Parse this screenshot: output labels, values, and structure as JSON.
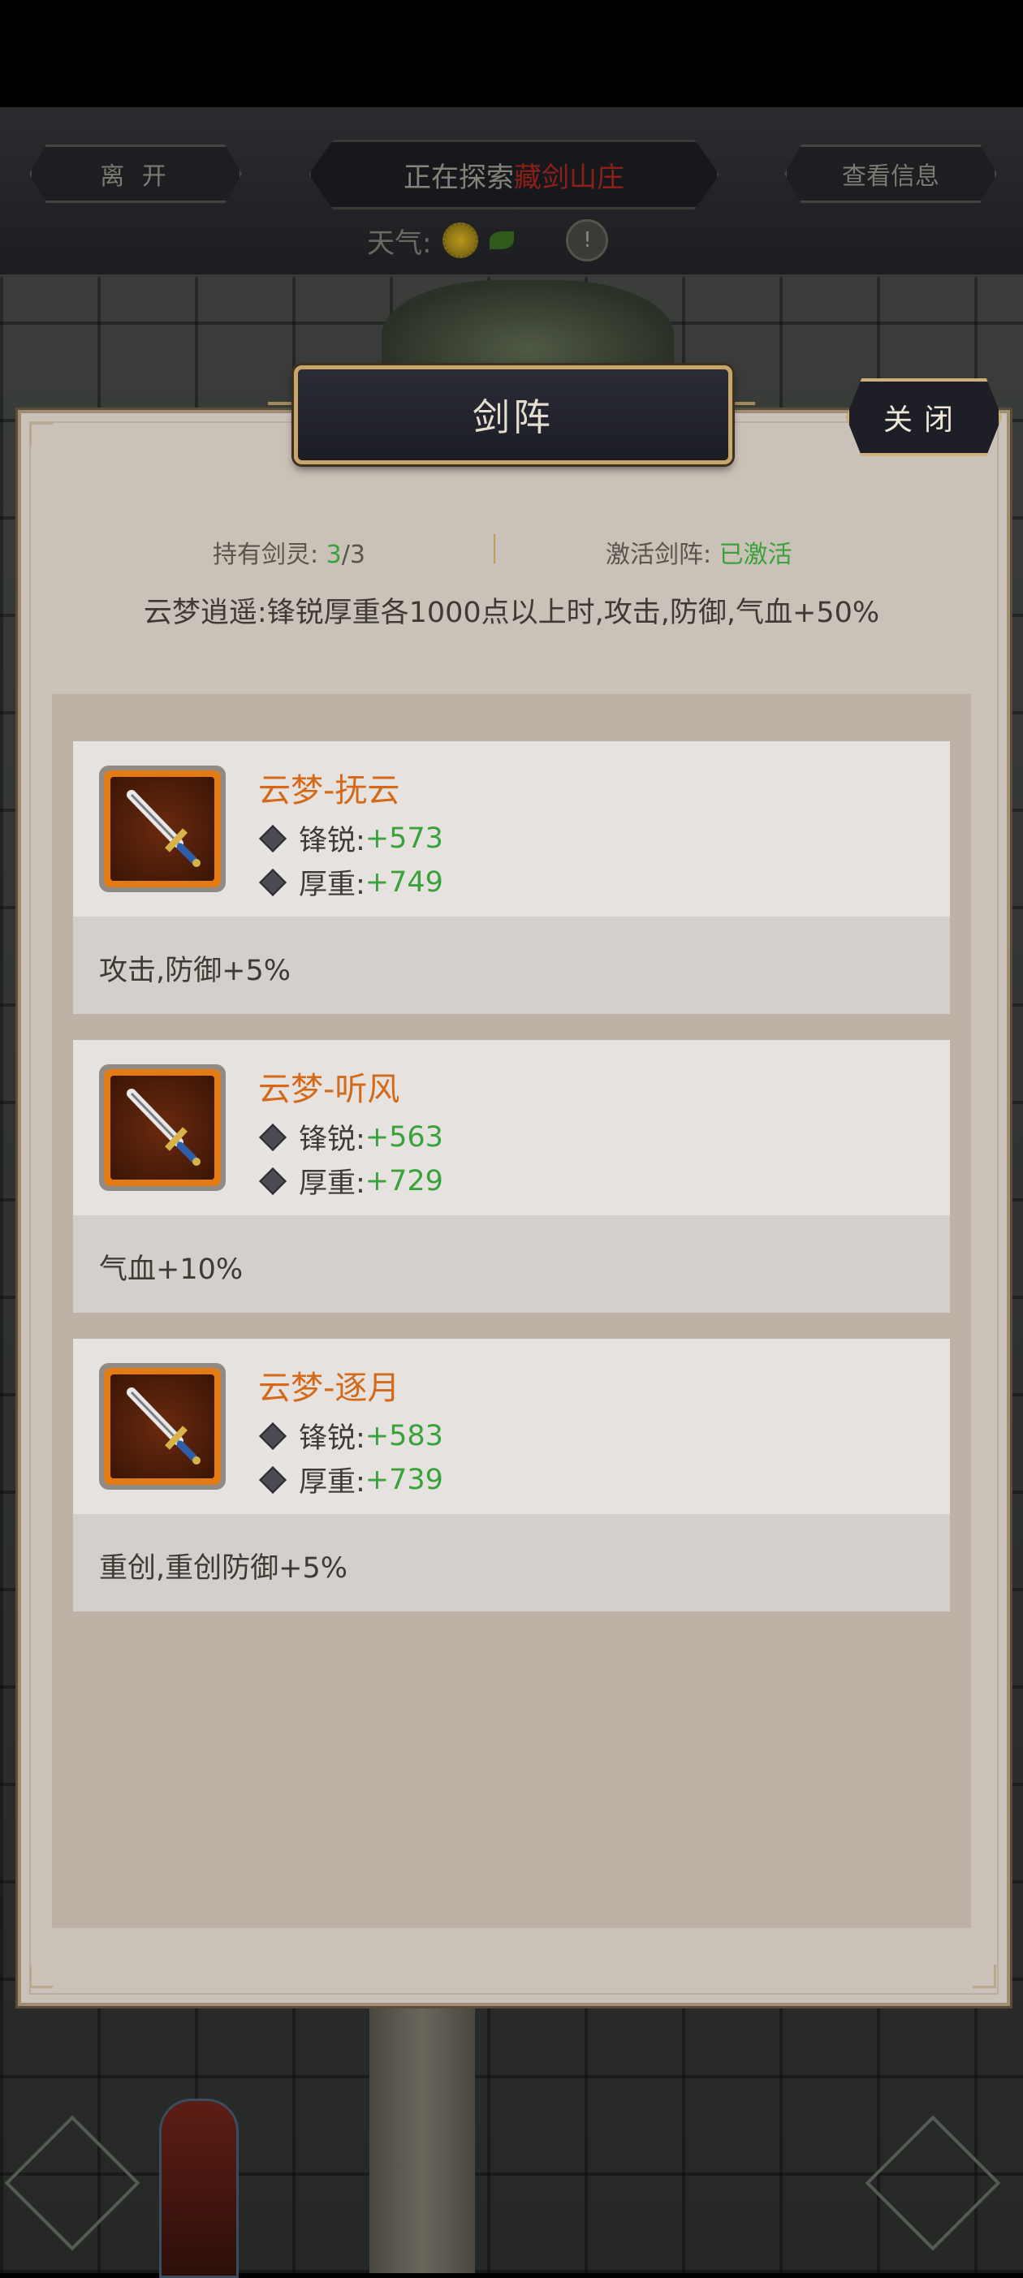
{
  "header": {
    "leave_label": "离 开",
    "exploring_prefix": "正在探索",
    "exploring_location": "藏剑山庄",
    "view_info_label": "查看信息",
    "weather_label": "天气:",
    "info_glyph": "!"
  },
  "dialog": {
    "title": "剑阵",
    "close_label": "关闭",
    "spirit_label": "持有剑灵:",
    "spirit_count": "3",
    "spirit_total": "/3",
    "formation_label": "激活剑阵:",
    "formation_status": "已激活",
    "description": "云梦逍遥:锋锐厚重各1000点以上时,攻击,防御,气血+50%"
  },
  "cards": [
    {
      "name": "云梦-抚云",
      "sharp_label": "锋锐:",
      "sharp_value": "+573",
      "heavy_label": "厚重:",
      "heavy_value": "+749",
      "effect": "攻击,防御+5%",
      "icon": "sword-icon"
    },
    {
      "name": "云梦-听风",
      "sharp_label": "锋锐:",
      "sharp_value": "+563",
      "heavy_label": "厚重:",
      "heavy_value": "+729",
      "effect": "气血+10%",
      "icon": "sword-icon"
    },
    {
      "name": "云梦-逐月",
      "sharp_label": "锋锐:",
      "sharp_value": "+583",
      "heavy_label": "厚重:",
      "heavy_value": "+739",
      "effect": "重创,重创防御+5%",
      "icon": "sword-icon"
    }
  ],
  "colors": {
    "accent_orange": "#d46a18",
    "value_green": "#3aa23a",
    "location_red": "#8b2019"
  }
}
